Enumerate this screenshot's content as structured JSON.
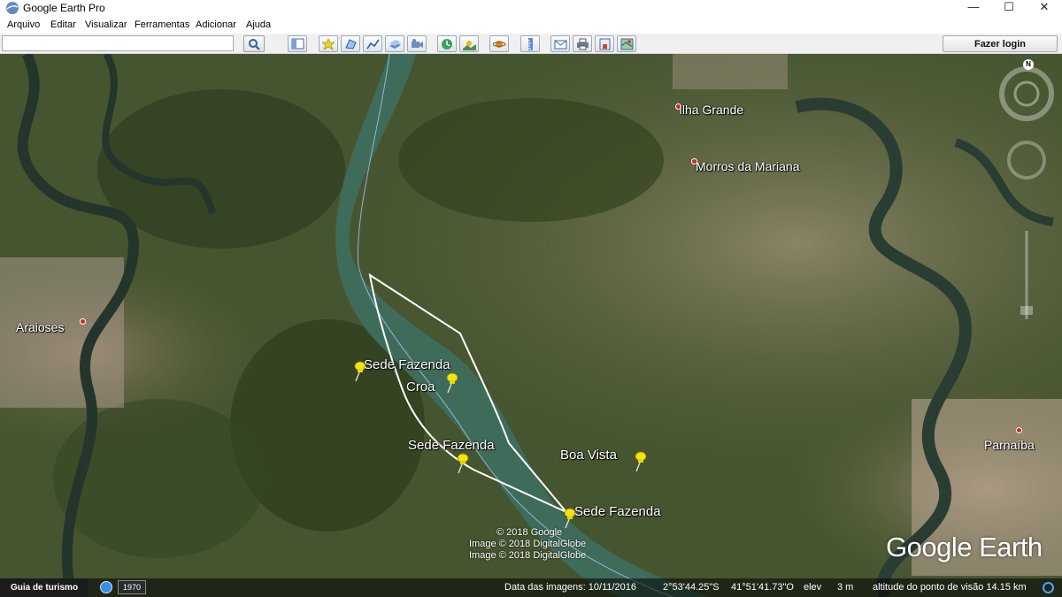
{
  "window": {
    "title": "Google Earth Pro",
    "minimize": "—",
    "maximize": "☐",
    "close": "✕"
  },
  "menu": [
    "Arquivo",
    "Editar",
    "Visualizar",
    "Ferramentas",
    "Adicionar",
    "Ajuda"
  ],
  "search": {
    "value": "",
    "placeholder": ""
  },
  "toolbar": {
    "login_label": "Fazer login",
    "icons": [
      "sidebar-icon",
      "placemark-icon",
      "polygon-icon",
      "path-icon",
      "image-overlay-icon",
      "record-tour-icon",
      "historical-imagery-icon",
      "sunlight-icon",
      "planets-icon",
      "ruler-icon",
      "email-icon",
      "print-icon",
      "save-image-icon",
      "view-in-maps-icon"
    ]
  },
  "map": {
    "places": {
      "ilha_grande": "Ilha Grande",
      "morros": "Morros da Mariana",
      "araioses": "Araioses",
      "parnaiba": "Parnaíba",
      "boa_vista": "Boa Vista",
      "sede1": "Sede Fazenda",
      "croa": "Croa",
      "sede2": "Sede Fazenda",
      "sede3": "Sede Fazenda"
    },
    "credits": [
      "© 2018 Google",
      "Image © 2018 DigitalGlobe",
      "Image © 2018 DigitalGlobe"
    ],
    "logo": "Google Earth",
    "north": "N"
  },
  "status": {
    "tour": "Guia de turismo",
    "year": "1970",
    "date": "Data das imagens: 10/11/2016",
    "lat": "2°53'44.25\"S",
    "lon": "41°51'41.73\"O",
    "elev_label": "elev",
    "elev": "3 m",
    "eye": "altitude do ponto de visão  14.15 km"
  },
  "colors": {
    "river": "#3f6b5a",
    "land": "#4a5a33",
    "pin": "#f3e312",
    "outline": "#ffffff"
  }
}
